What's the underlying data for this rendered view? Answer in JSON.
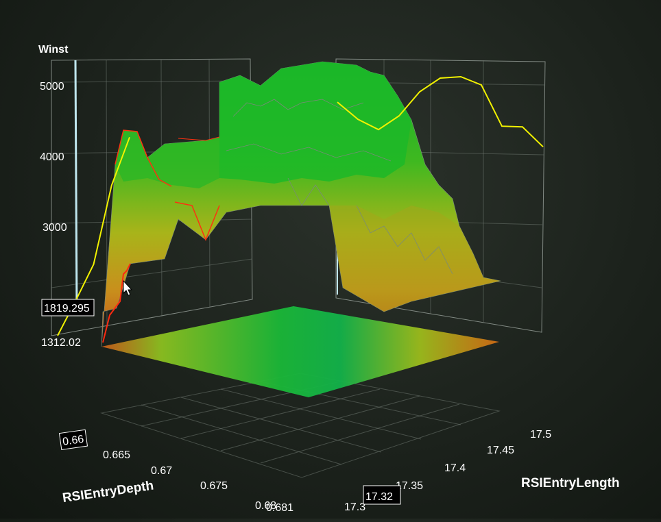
{
  "chart_data": {
    "type": "surface3d",
    "z_axis": {
      "label": "Winst",
      "ticks": [
        3000,
        4000,
        5000
      ],
      "min_label": "1312.02",
      "cursor_label": "1819.295"
    },
    "x_axis": {
      "label": "RSIEntryDepth",
      "ticks": [
        "0.66",
        "0.665",
        "0.67",
        "0.675",
        "0.68"
      ],
      "end_label": "0.681",
      "cursor_label": "0.66"
    },
    "y_axis": {
      "label": "RSIEntryLength",
      "ticks": [
        "17.3",
        "17.35",
        "17.4",
        "17.45",
        "17.5"
      ],
      "cursor_label": "17.32"
    },
    "projection_line": {
      "color": "#f2f200",
      "values": [
        1312,
        1819,
        2350,
        3500,
        4200,
        4750,
        4500,
        4350,
        4550,
        4900,
        5100,
        5120,
        5000,
        4400,
        4390,
        4100
      ]
    },
    "surface_colors": {
      "low": "#c8401a",
      "mid": "#b0c21a",
      "high": "#10b030"
    }
  }
}
